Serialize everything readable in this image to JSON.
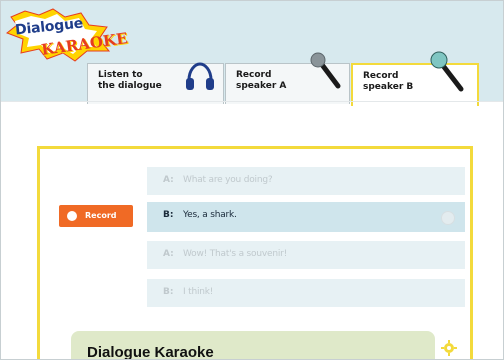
{
  "logo": {
    "line1": "Dialogue",
    "line2": "KARAOKE"
  },
  "tabs": [
    {
      "label": "Listen to\nthe dialogue",
      "icon": "headphones-icon"
    },
    {
      "label": "Record\nspeaker A",
      "icon": "microphone-icon"
    },
    {
      "label": "Record\nspeaker B",
      "icon": "microphone-icon"
    }
  ],
  "record_button": {
    "label": "Record"
  },
  "dialogue": {
    "lines": [
      {
        "speaker": "A:",
        "text": "What are you doing?"
      },
      {
        "speaker": "B:",
        "text": "Yes, a shark."
      },
      {
        "speaker": "A:",
        "text": "Wow! That's a souvenir!"
      },
      {
        "speaker": "B:",
        "text": "I think!"
      }
    ]
  },
  "caption": {
    "title": "Dialogue Karaoke"
  },
  "colors": {
    "accent_yellow": "#f3da3c",
    "record_orange": "#f06a25",
    "top_band": "#d7e9ee",
    "caption_bg": "#dfe9c9"
  }
}
